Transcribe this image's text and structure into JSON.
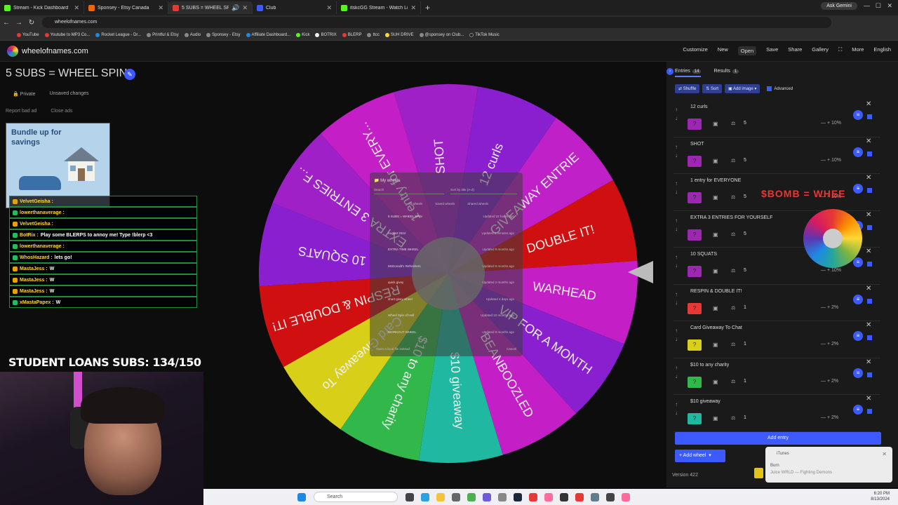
{
  "browser": {
    "tabs": [
      {
        "title": "Stream - Kick Dashboard",
        "color": "#53fc18"
      },
      {
        "title": "Sponsey - Etsy Canada",
        "color": "#f56400"
      },
      {
        "title": "5 SUBS = WHEEL SPIN",
        "color": "#e53935"
      },
      {
        "title": "Club",
        "color": "#3d5afe"
      },
      {
        "title": "itskcGG Stream - Watch Live on",
        "color": "#53fc18"
      }
    ],
    "new_tab": "+",
    "ask_gemini": "Ask Gemini",
    "url": "wheelofnames.com",
    "bookmarks": [
      {
        "label": "YouTube",
        "color": "#e53935"
      },
      {
        "label": "Youtube to MP3 Co...",
        "color": "#e53935"
      },
      {
        "label": "Rocket League - Dr...",
        "color": "#1e88e5"
      },
      {
        "label": "Printful & Etsy",
        "color": "#888888"
      },
      {
        "label": "Audio",
        "color": "#888888"
      },
      {
        "label": "Sponsey - Etsy",
        "color": "#888888"
      },
      {
        "label": "Affiliate Dashboard...",
        "color": "#1e88e5"
      },
      {
        "label": "Kick",
        "color": "#53fc18"
      },
      {
        "label": "BOTRIX",
        "color": "#eeeeee"
      },
      {
        "label": "BLERP",
        "color": "#e53935"
      },
      {
        "label": "ttcc",
        "color": "#888888"
      },
      {
        "label": "SUH DRIVE",
        "color": "#fdd835"
      },
      {
        "label": "@sponsey on Club...",
        "color": "#888888"
      },
      {
        "label": "TikTok Music",
        "color": "#222222"
      }
    ]
  },
  "app": {
    "logo_text": "wheelofnames.com",
    "menu": [
      "Customize",
      "New",
      "Open",
      "Save",
      "Share",
      "Gallery",
      "Fullscreen",
      "More",
      "English"
    ],
    "wheel_title": "5 SUBS = WHEEL SPIN",
    "private": "Private",
    "unsaved": "Unsaved changes",
    "report_ad": "Report bad ad",
    "close_ads": "Close ads"
  },
  "ad": {
    "text": "Bundle up for savings"
  },
  "chat": [
    {
      "name": "VelvetGeisha :",
      "msg": "",
      "badge": "y"
    },
    {
      "name": "lowerthanaverage :",
      "msg": "",
      "badge": "g"
    },
    {
      "name": "VelvetGeisha :",
      "msg": "",
      "badge": "y"
    },
    {
      "name": "BotRix :",
      "msg": "Play some BLERPS to annoy me! Type !blerp <3",
      "badge": "g"
    },
    {
      "name": "lowerthanaverage :",
      "msg": "",
      "badge": "g"
    },
    {
      "name": "WhosHazard :",
      "msg": "lets go!",
      "badge": "g"
    },
    {
      "name": "MastaJess :",
      "msg": "W",
      "badge": "y"
    },
    {
      "name": "MastaJess :",
      "msg": "W",
      "badge": "y"
    },
    {
      "name": "MastaJess :",
      "msg": "W",
      "badge": "y"
    },
    {
      "name": "xMastaPapex :",
      "msg": "W",
      "badge": "g"
    }
  ],
  "stream_title": "STUDENT LOANS SUBS: 134/150",
  "wheel": {
    "segments": [
      {
        "label": "SHOT",
        "color": "#a020c8"
      },
      {
        "label": "12 curls",
        "color": "#8a1fd0"
      },
      {
        "label": "GIVEAWAY ENTRIE",
        "color": "#c020c8"
      },
      {
        "label": "DOUBLE IT!",
        "color": "#d01010"
      },
      {
        "label": "WARHEAD",
        "color": "#c41ec6"
      },
      {
        "label": "VIP FOR A MONTH",
        "color": "#8a1fd0"
      },
      {
        "label": "BEANBOOZLED",
        "color": "#c41ec6"
      },
      {
        "label": "$10 giveaway",
        "color": "#20b8a0"
      },
      {
        "label": "$10 to any charity",
        "color": "#32b84a"
      },
      {
        "label": "Card Giveaway To",
        "color": "#d8d018"
      },
      {
        "label": "RESPIN & DOUBLE IT!",
        "color": "#d01010"
      },
      {
        "label": "10 SQUATS",
        "color": "#8a1fd0"
      },
      {
        "label": "EXTRA 3 ENTRIES F...",
        "color": "#a020c8"
      },
      {
        "label": "1 entry for EVERY...",
        "color": "#c41ec6"
      }
    ]
  },
  "dialog": {
    "title": "My wheels",
    "search": "Search",
    "sort": "Sort by title (A-Z)",
    "tabs": [
      "All wheels",
      "Saved wheels",
      "Shared wheels"
    ],
    "rows": [
      {
        "name": "5 SUBS = WHEEL SPIN",
        "updated": "Updated 22 hours ago"
      },
      {
        "name": "August 2024",
        "updated": "Updated 3 minutes ago"
      },
      {
        "name": "EXTRA TIME WHEEL",
        "updated": "Updated 9 months ago"
      },
      {
        "name": "McDonald's Refreshers",
        "updated": "Updated 9 months ago"
      },
      {
        "name": "quick givey",
        "updated": "Updated 2 months ago"
      },
      {
        "name": "short givey wheel",
        "updated": "Updated 4 days ago"
      },
      {
        "name": "Wheel Spin of Hell",
        "updated": "Updated 10 months ago"
      },
      {
        "name": "WORKOUT WHEEL",
        "updated": "Updated 8 months ago"
      }
    ],
    "open_local": "Open a local file instead",
    "cancel": "Cancel"
  },
  "panel": {
    "entries_tab": "Entries",
    "entries_count": "14",
    "results_tab": "Results",
    "results_count": "1",
    "shuffle": "Shuffle",
    "sort": "Sort",
    "add_image": "Add image",
    "advanced": "Advanced",
    "entries": [
      {
        "text": "12 curls",
        "color": "#9c27b0",
        "weight": "5",
        "pct": "10%"
      },
      {
        "text": "SHOT",
        "color": "#9c27b0",
        "weight": "5",
        "pct": "10%"
      },
      {
        "text": "1 entry for EVERYONE",
        "color": "#9c27b0",
        "weight": "5",
        "pct": "10%"
      },
      {
        "text": "EXTRA 3 ENTRIES FOR YOURSELF",
        "color": "#9c27b0",
        "weight": "5",
        "pct": "10%"
      },
      {
        "text": "10 SQUATS",
        "color": "#9c27b0",
        "weight": "5",
        "pct": "10%"
      },
      {
        "text": "RESPIN & DOUBLE IT!",
        "color": "#e53935",
        "weight": "1",
        "pct": "2%"
      },
      {
        "text": "Card Giveaway To Chat",
        "color": "#d8d018",
        "weight": "1",
        "pct": "2%"
      },
      {
        "text": "$10 to any charity",
        "color": "#32b84a",
        "weight": "1",
        "pct": "2%"
      },
      {
        "text": "$10 giveaway",
        "color": "#20b8a0",
        "weight": "1",
        "pct": "2%"
      }
    ],
    "add_entry": "Add entry",
    "add_wheel": "Add wheel",
    "version": "Version 422"
  },
  "overlay": {
    "bomb_text": "$BOMB = WHEE"
  },
  "toast": {
    "app": "iTunes",
    "title": "Burn",
    "subtitle": "Juice WRLD — Fighting Demons"
  },
  "taskbar": {
    "search": "Search",
    "time": "6:20 PM",
    "date": "8/13/2024"
  }
}
